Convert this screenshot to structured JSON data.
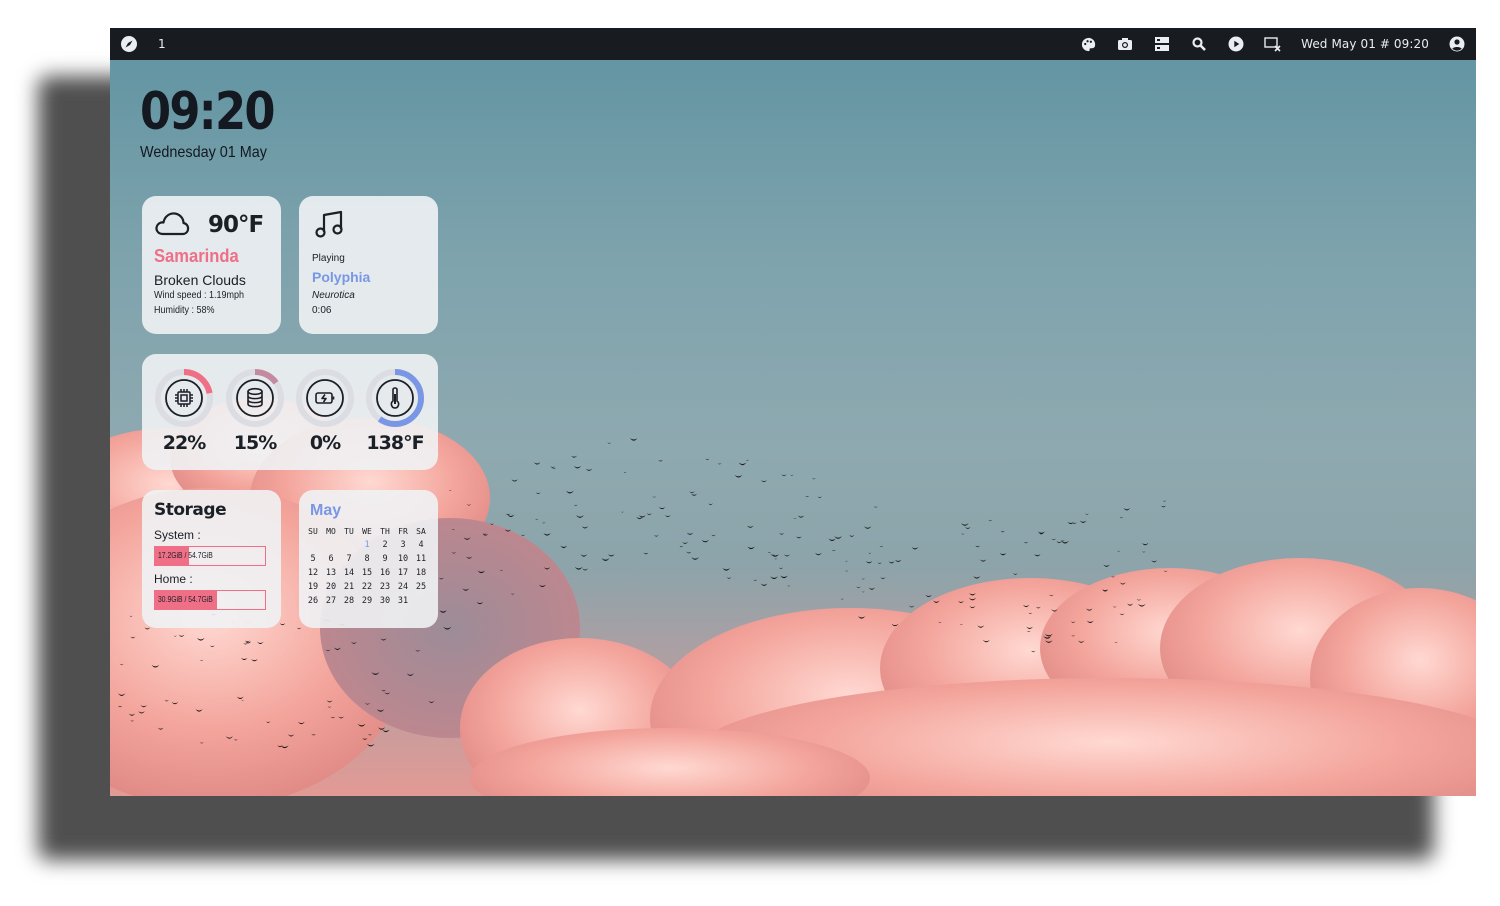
{
  "topbar": {
    "launcher_icon": "compass-icon",
    "workspace": "1",
    "tray_icons": [
      "palette-icon",
      "camera-icon",
      "server-icon",
      "search-icon",
      "play-icon",
      "screen-off-icon"
    ],
    "clock": "Wed May 01 # 09:20",
    "user_icon": "user-circle-icon"
  },
  "desktop_clock": {
    "time": "09:20",
    "date": "Wednesday 01 May"
  },
  "weather": {
    "icon": "cloud-icon",
    "temperature": "90°F",
    "city": "Samarinda",
    "condition": "Broken Clouds",
    "wind": "Wind speed : 1.19mph",
    "humidity": "Humidity : 58%"
  },
  "music": {
    "icon": "music-note-icon",
    "status": "Playing",
    "artist": "Polyphia",
    "album": "Neurotica",
    "position": "0:06"
  },
  "stats": [
    {
      "name": "cpu",
      "icon": "cpu-icon",
      "value": "22%",
      "fraction": 0.22,
      "color": "#ef6f86"
    },
    {
      "name": "ram",
      "icon": "database-icon",
      "value": "15%",
      "fraction": 0.15,
      "color": "#c48aa0"
    },
    {
      "name": "battery",
      "icon": "battery-charging-icon",
      "value": "0%",
      "fraction": 0.0,
      "color": "#8aa0e8"
    },
    {
      "name": "temperature",
      "icon": "thermometer-icon",
      "value": "138°F",
      "fraction": 0.6,
      "color": "#7a97e6"
    }
  ],
  "storage": {
    "title": "Storage",
    "system_label": "System :",
    "system_usage": "17.2GiB / 54.7GiB",
    "system_fraction": 0.31,
    "home_label": "Home :",
    "home_usage": "30.9GiB / 54.7GiB",
    "home_fraction": 0.56
  },
  "calendar": {
    "month": "May",
    "weekdays": [
      "SU",
      "MO",
      "TU",
      "WE",
      "TH",
      "FR",
      "SA"
    ],
    "days": [
      "",
      "",
      "",
      "1",
      "2",
      "3",
      "4",
      "5",
      "6",
      "7",
      "8",
      "9",
      "10",
      "11",
      "12",
      "13",
      "14",
      "15",
      "16",
      "17",
      "18",
      "19",
      "20",
      "21",
      "22",
      "23",
      "24",
      "25",
      "26",
      "27",
      "28",
      "29",
      "30",
      "31",
      ""
    ],
    "today": "1"
  },
  "colors": {
    "accent_pink": "#ef6f86",
    "accent_blue": "#7a97e6",
    "bar_bg": "#181b1f"
  }
}
